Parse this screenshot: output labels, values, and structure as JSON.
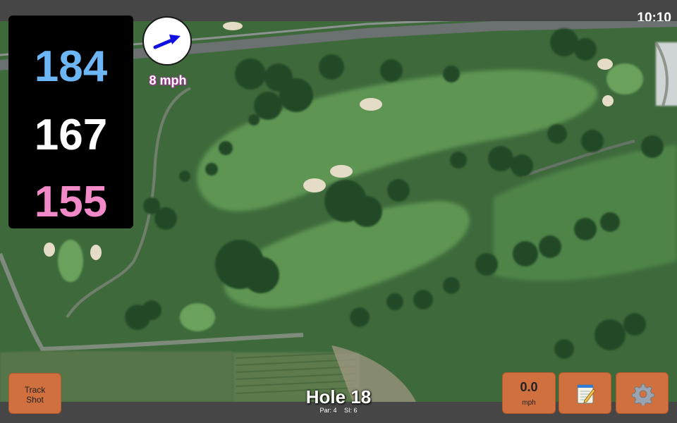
{
  "status": {
    "clock": "10:10"
  },
  "distances": {
    "back": "184",
    "middle": "167",
    "front": "155",
    "back_color": "#6cb6f5",
    "middle_color": "#ffffff",
    "front_color": "#f289c8"
  },
  "wind": {
    "speed": "8 mph",
    "arrow_icon": "wind-arrow-icon",
    "arrow_color": "#1010e0"
  },
  "buttons": {
    "track_shot_line1": "Track",
    "track_shot_line2": "Shot",
    "speed_value": "0.0",
    "speed_unit": "mph",
    "notes_icon": "notepad-icon",
    "settings_icon": "gear-icon",
    "button_color": "#d0703f"
  },
  "hole": {
    "title": "Hole 18",
    "par": "Par: 4",
    "si": "SI: 6"
  }
}
